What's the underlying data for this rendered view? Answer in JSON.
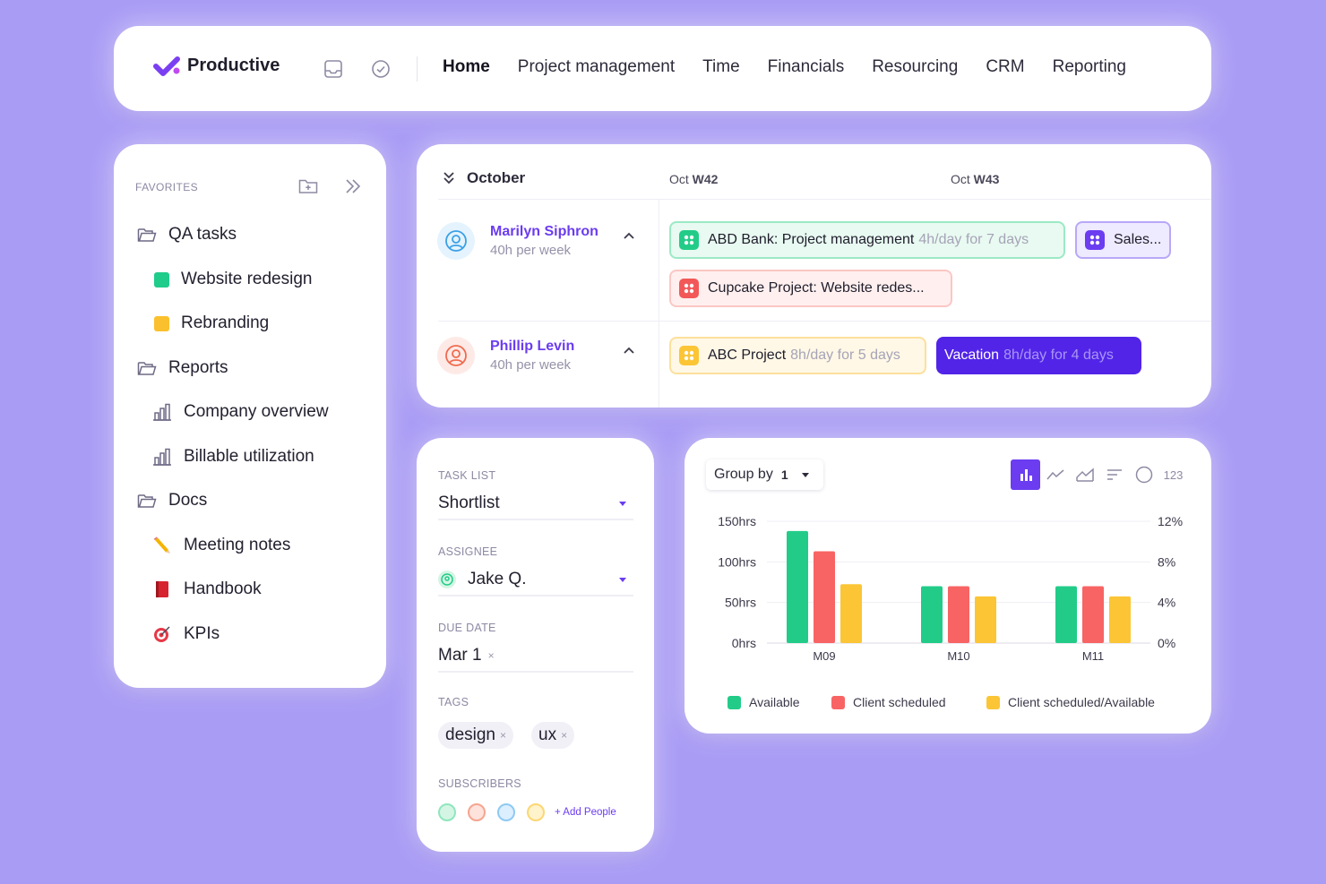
{
  "nav": {
    "brand": "Productive",
    "links": [
      "Home",
      "Project management",
      "Time",
      "Financials",
      "Resourcing",
      "CRM",
      "Reporting"
    ],
    "active": "Home",
    "icons": [
      "inbox-icon",
      "check-circle-icon"
    ]
  },
  "favorites": {
    "title": "FAVORITES",
    "items": [
      {
        "label": "QA tasks",
        "icon": "folder-icon"
      },
      {
        "label": "Website redesign",
        "icon": "green-square",
        "color": "#1fcc8a"
      },
      {
        "label": "Rebranding",
        "icon": "yellow-square",
        "color": "#fbc02d"
      },
      {
        "label": "Reports",
        "icon": "folder-icon"
      },
      {
        "label": "Company overview",
        "icon": "chart-icon"
      },
      {
        "label": "Billable utilization",
        "icon": "chart-icon"
      },
      {
        "label": "Docs",
        "icon": "folder-icon"
      },
      {
        "label": "Meeting notes",
        "icon": "pencil-icon"
      },
      {
        "label": "Handbook",
        "icon": "book-icon"
      },
      {
        "label": "KPIs",
        "icon": "target-icon"
      }
    ]
  },
  "schedule": {
    "month": "October",
    "weeks": [
      {
        "prefix": "Oct",
        "week": "W42"
      },
      {
        "prefix": "Oct",
        "week": "W43"
      }
    ],
    "people": [
      {
        "name": "Marilyn Siphron",
        "capacity": "40h per week",
        "bookings": [
          {
            "title": "ABD Bank: Project management",
            "detail": "4h/day for 7 days",
            "color": "green"
          },
          {
            "title": "Sales...",
            "detail": "",
            "color": "purple"
          },
          {
            "title": "Cupcake Project: Website redes...",
            "detail": "",
            "color": "red"
          }
        ]
      },
      {
        "name": "Phillip Levin",
        "capacity": "40h per week",
        "bookings": [
          {
            "title": "ABC Project",
            "detail": "8h/day for 5 days",
            "color": "yellow"
          },
          {
            "title": "Vacation",
            "detail": "8h/day for 4 days",
            "color": "violet"
          }
        ]
      }
    ]
  },
  "task": {
    "list_label": "TASK LIST",
    "list_value": "Shortlist",
    "assignee_label": "ASSIGNEE",
    "assignee_value": "Jake Q.",
    "due_label": "DUE DATE",
    "due_value": "Mar 1",
    "tags_label": "TAGS",
    "tags": [
      "design",
      "ux"
    ],
    "subscribers_label": "SUBSCRIBERS",
    "add_people": "+ Add People",
    "remove_glyph": "×"
  },
  "chart_controls": {
    "group_by": "Group by",
    "group_by_value": "1",
    "types": [
      "bar-chart-icon",
      "line-chart-icon",
      "area-chart-icon",
      "sort-lines-icon",
      "pie-circle-icon"
    ],
    "number_label": "123",
    "active_type": "bar-chart-icon"
  },
  "chart_data": {
    "type": "bar",
    "categories": [
      "M09",
      "M10",
      "M11"
    ],
    "series": [
      {
        "name": "Available",
        "values": [
          138,
          70,
          70
        ],
        "axis": "left",
        "color": "#22cc88"
      },
      {
        "name": "Client scheduled",
        "values": [
          113,
          70,
          70
        ],
        "axis": "left",
        "color": "#f86464"
      },
      {
        "name": "Client scheduled/Available",
        "values": [
          5.8,
          4.6,
          4.6
        ],
        "axis": "right",
        "color": "#fbc536"
      }
    ],
    "y_left": {
      "ticks": [
        "0hrs",
        "50hrs",
        "100hrs",
        "150hrs"
      ],
      "ylim": [
        0,
        150
      ]
    },
    "y_right": {
      "ticks": [
        "0%",
        "4%",
        "8%",
        "12%"
      ],
      "ylim": [
        0,
        12
      ]
    },
    "grid": true,
    "legend_position": "bottom"
  }
}
